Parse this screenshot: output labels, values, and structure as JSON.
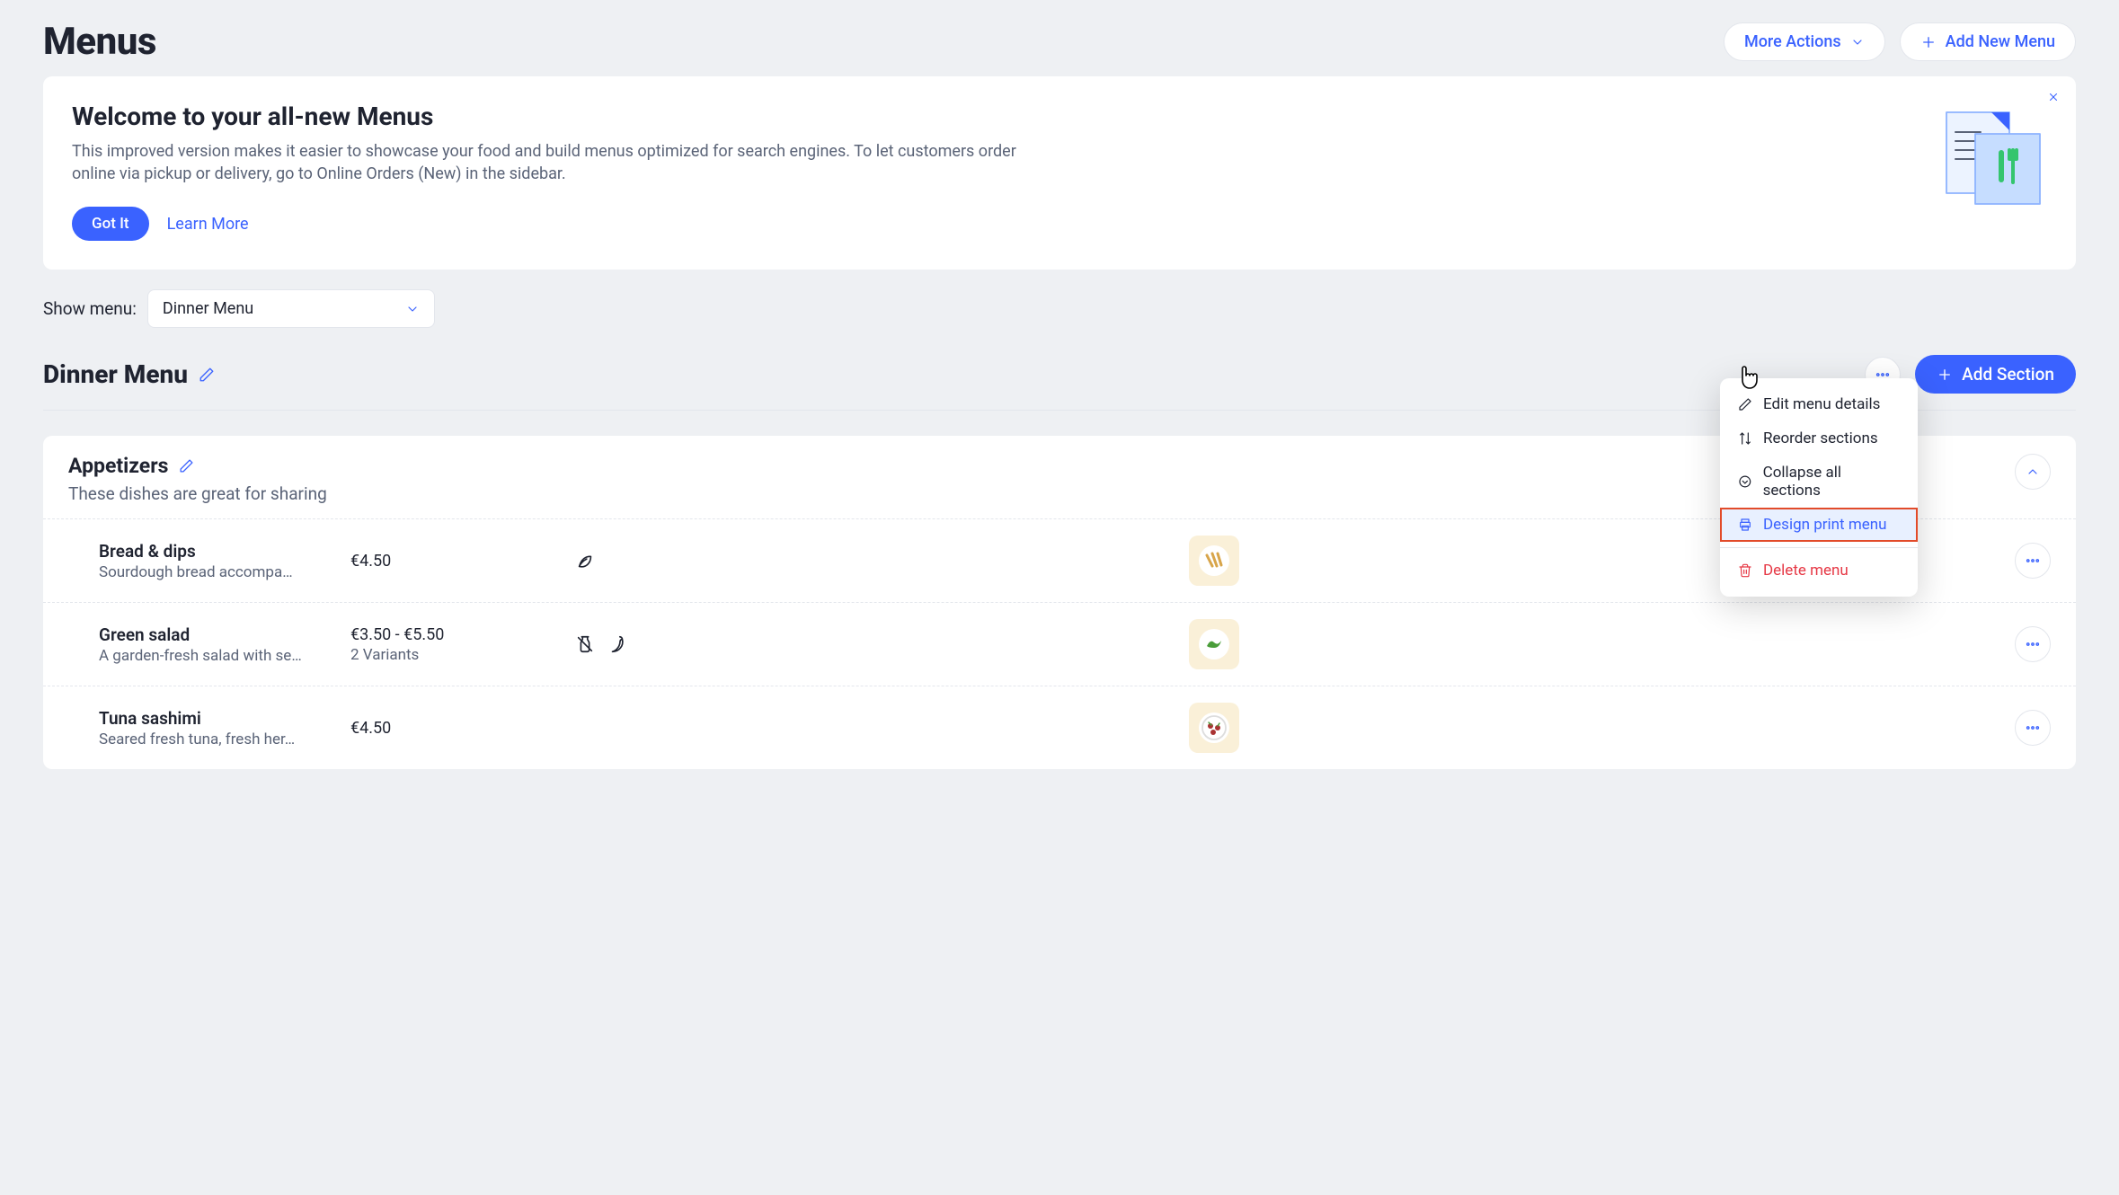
{
  "header": {
    "title": "Menus",
    "more_actions": "More Actions",
    "add_new": "Add New Menu"
  },
  "banner": {
    "title": "Welcome to your all-new Menus",
    "desc": "This improved version makes it easier to showcase your food and build menus optimized for search engines.  To let customers order online via pickup or delivery, go to Online Orders (New) in the sidebar.",
    "got_it": "Got It",
    "learn_more": "Learn More"
  },
  "filter": {
    "label": "Show menu:",
    "selected": "Dinner Menu"
  },
  "menu": {
    "name": "Dinner Menu",
    "add_section": "Add Section"
  },
  "dropdown": {
    "edit": "Edit menu details",
    "reorder": "Reorder sections",
    "collapse": "Collapse all sections",
    "design": "Design print menu",
    "delete": "Delete menu"
  },
  "section": {
    "title": "Appetizers",
    "subtitle": "These dishes are great for sharing",
    "items": [
      {
        "name": "Bread & dips",
        "desc": "Sourdough bread accompa…",
        "price": "€4.50",
        "variants": ""
      },
      {
        "name": "Green salad",
        "desc": "A garden-fresh salad with se…",
        "price": "€3.50 - €5.50",
        "variants": "2 Variants"
      },
      {
        "name": "Tuna sashimi",
        "desc": "Seared fresh tuna, fresh her…",
        "price": "€4.50",
        "variants": ""
      }
    ]
  }
}
